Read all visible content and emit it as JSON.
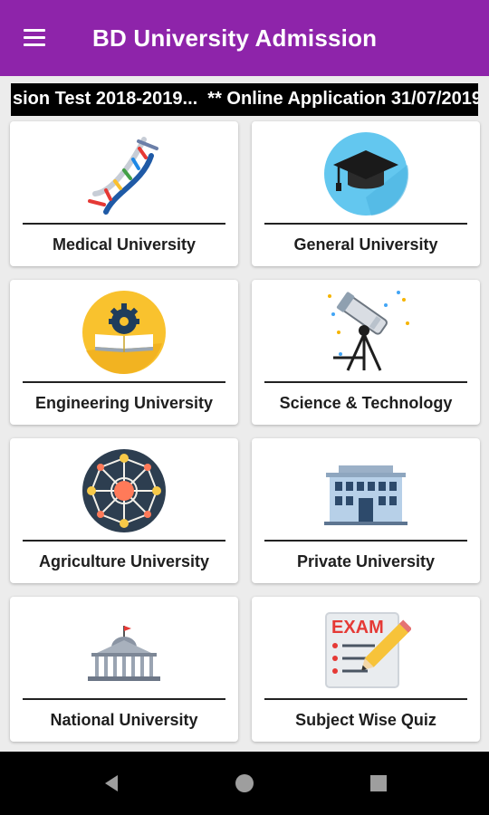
{
  "app": {
    "title": "BD University Admission"
  },
  "icons": {
    "menu": "menu-icon",
    "back": "back-triangle-icon",
    "home": "home-circle-icon",
    "recents": "recents-square-icon"
  },
  "colors": {
    "appbar": "#8e24aa",
    "marquee_bg": "#000000",
    "page_bg": "#ececec",
    "navbar": "#000000"
  },
  "marquee": {
    "text": "sion Test 2018-2019...  ** Online Application 31/07/2019"
  },
  "cards": [
    {
      "label": "Medical University",
      "icon": "dna-icon"
    },
    {
      "label": "General University",
      "icon": "graduation-cap-icon"
    },
    {
      "label": "Engineering University",
      "icon": "gear-book-icon"
    },
    {
      "label": "Science & Technology",
      "icon": "telescope-icon"
    },
    {
      "label": "Agriculture University",
      "icon": "network-icon"
    },
    {
      "label": "Private University",
      "icon": "university-building-icon"
    },
    {
      "label": "National University",
      "icon": "capitol-building-icon"
    },
    {
      "label": "Subject Wise Quiz",
      "icon": "exam-icon"
    }
  ]
}
